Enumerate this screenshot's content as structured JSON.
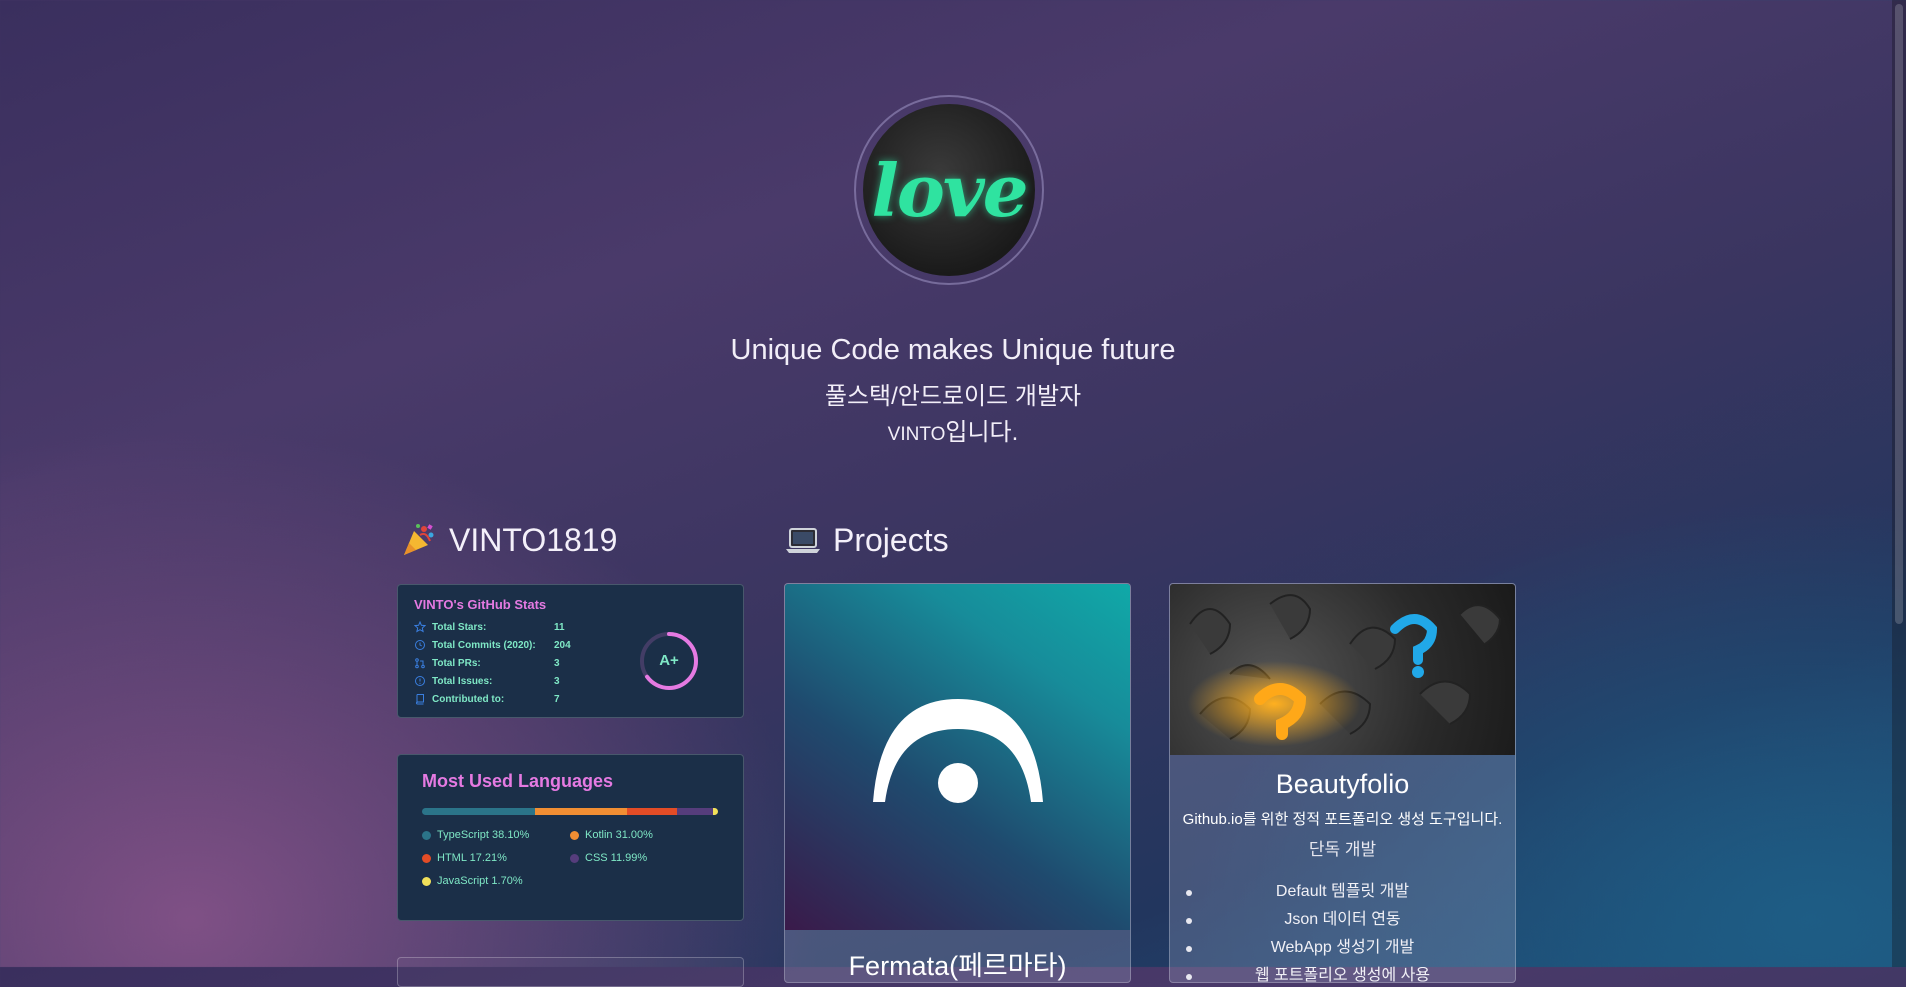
{
  "hero": {
    "line1": "Unique Code makes Unique future",
    "line2": "풀스택/안드로이드 개발자",
    "name_small": "VINTO",
    "name_suffix": "입니다.",
    "avatar_text": "love"
  },
  "sections": {
    "profile_title": "VINTO1819",
    "projects_title": "Projects"
  },
  "github_stats": {
    "title": "VINTO's GitHub Stats",
    "rows": [
      {
        "label": "Total Stars:",
        "value": "11",
        "icon": "star-icon"
      },
      {
        "label": "Total Commits (2020):",
        "value": "204",
        "icon": "clock-icon"
      },
      {
        "label": "Total PRs:",
        "value": "3",
        "icon": "pull-request-icon"
      },
      {
        "label": "Total Issues:",
        "value": "3",
        "icon": "issue-icon"
      },
      {
        "label": "Contributed to:",
        "value": "7",
        "icon": "repo-icon"
      }
    ],
    "grade": "A+",
    "grade_progress": 0.65
  },
  "languages": {
    "title": "Most Used Languages",
    "items": [
      {
        "name": "TypeScript",
        "percent": 38.1,
        "text": "TypeScript 38.10%",
        "color": "#2b7489"
      },
      {
        "name": "Kotlin",
        "percent": 31.0,
        "text": "Kotlin 31.00%",
        "color": "#F18E33"
      },
      {
        "name": "HTML",
        "percent": 17.21,
        "text": "HTML 17.21%",
        "color": "#e34c26"
      },
      {
        "name": "CSS",
        "percent": 11.99,
        "text": "CSS 11.99%",
        "color": "#563d7c"
      },
      {
        "name": "JavaScript",
        "percent": 1.7,
        "text": "JavaScript 1.70%",
        "color": "#f1e05a"
      }
    ]
  },
  "projects": [
    {
      "title": "Fermata(페르마타)"
    },
    {
      "title": "Beautyfolio",
      "description": "Github.io를 위한 정적 포트폴리오 생성 도구입니다.",
      "role": "단독 개발",
      "features": [
        "Default 템플릿 개발",
        "Json 데이터 연동",
        "WebApp 생성기 개발",
        "웹 포트폴리오 생성에 사용"
      ]
    }
  ],
  "colors": {
    "card_bg": "#1b2f48",
    "stat_title": "#e57ae2",
    "stat_text": "#7fe8c6",
    "avatar_text": "#2fe3a0"
  }
}
